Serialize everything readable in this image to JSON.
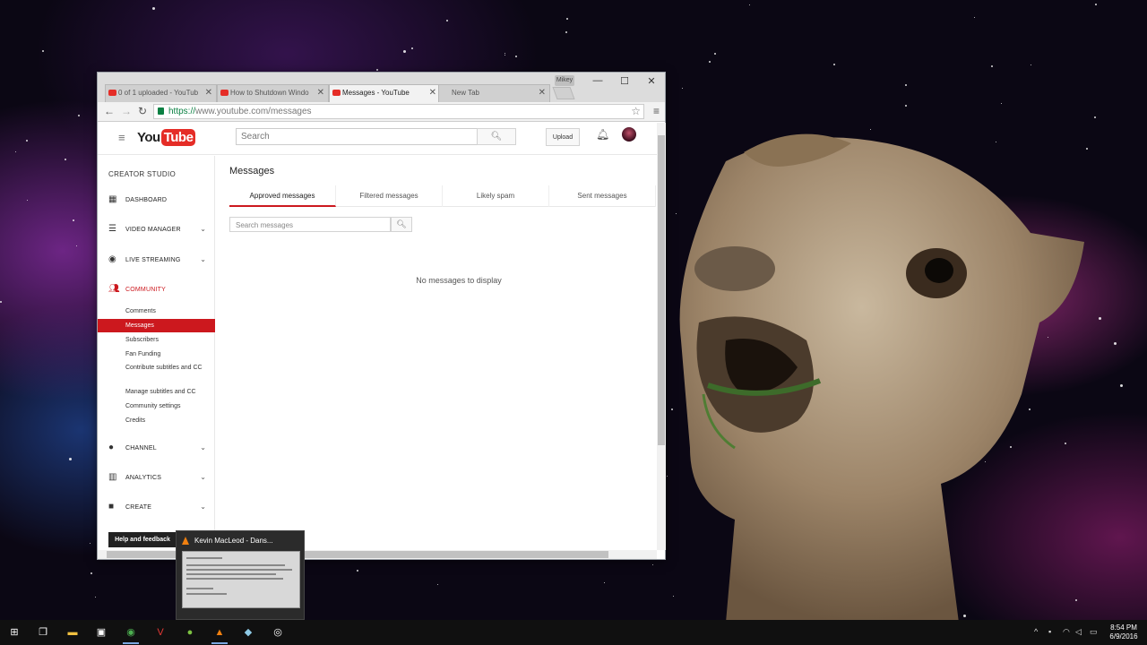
{
  "browser": {
    "tabs": [
      {
        "label": "0 of 1 uploaded - YouTub",
        "active": false
      },
      {
        "label": "How to Shutdown Windo",
        "active": false
      },
      {
        "label": "Messages - YouTube",
        "active": true
      },
      {
        "label": "New Tab",
        "active": false
      }
    ],
    "profile_label": "Mikey",
    "url_scheme": "https://",
    "url_rest": "www.youtube.com/messages"
  },
  "masthead": {
    "logo_you": "You",
    "logo_tube": "Tube",
    "search_placeholder": "Search",
    "upload_label": "Upload"
  },
  "sidebar": {
    "title": "CREATOR STUDIO",
    "sections": {
      "dashboard": "DASHBOARD",
      "video_manager": "VIDEO MANAGER",
      "live_streaming": "LIVE STREAMING",
      "community": "COMMUNITY",
      "channel": "CHANNEL",
      "analytics": "ANALYTICS",
      "create": "CREATE"
    },
    "community_items": [
      "Comments",
      "Messages",
      "Subscribers",
      "Fan Funding",
      "Contribute subtitles and CC",
      "Manage subtitles and CC",
      "Community settings",
      "Credits"
    ],
    "selected_item": "Messages",
    "help_label": "Help and feedback"
  },
  "main": {
    "title": "Messages",
    "tabs": [
      "Approved messages",
      "Filtered messages",
      "Likely spam",
      "Sent messages"
    ],
    "active_tab": "Approved messages",
    "search_placeholder": "Search messages",
    "empty_text": "No messages to display"
  },
  "taskbar": {
    "thumbnail_title": "Kevin MacLeod - Dans...",
    "clock_time": "8:54 PM",
    "clock_date": "6/9/2016"
  },
  "colors": {
    "youtube_red": "#cc181e",
    "taskbar": "#101010"
  }
}
